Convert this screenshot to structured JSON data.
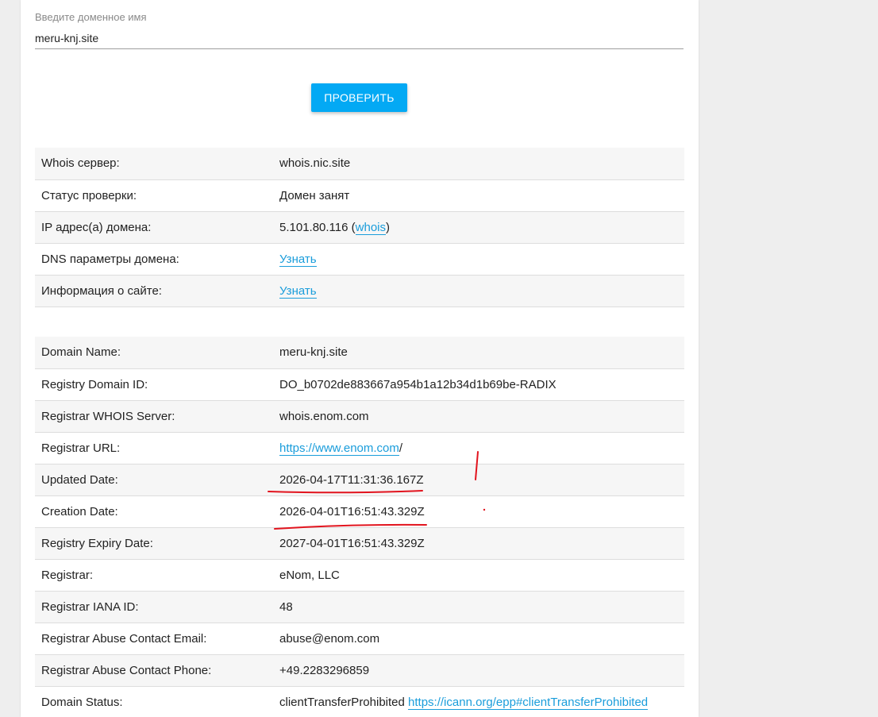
{
  "search": {
    "label": "Введите доменное имя",
    "value": "meru-knj.site"
  },
  "check_button": {
    "label": "ПРОВЕРИТЬ"
  },
  "summary": {
    "whois_server": {
      "key": "Whois сервер:",
      "value": "whois.nic.site"
    },
    "status": {
      "key": "Статус проверки:",
      "value": "Домен занят"
    },
    "ip": {
      "key": "IP адрес(а) домена:",
      "value": "5.101.80.116",
      "open": " (",
      "link": "whois",
      "close": ")"
    },
    "dns": {
      "key": "DNS параметры домена:",
      "link": "Узнать"
    },
    "site_info": {
      "key": "Информация о сайте:",
      "link": "Узнать"
    }
  },
  "whois": {
    "domain_name": {
      "key": "Domain Name:",
      "value": "meru-knj.site"
    },
    "registry_domain_id": {
      "key": "Registry Domain ID:",
      "value": "DO_b0702de883667a954b1a12b34d1b69be-RADIX"
    },
    "registrar_whois_server": {
      "key": "Registrar WHOIS Server:",
      "value": "whois.enom.com"
    },
    "registrar_url": {
      "key": "Registrar URL:",
      "link": "https://www.enom.com",
      "suffix": "/"
    },
    "updated_date": {
      "key": "Updated Date:",
      "value": "2026-04-17T11:31:36.167Z"
    },
    "creation_date": {
      "key": "Creation Date:",
      "value": "2026-04-01T16:51:43.329Z"
    },
    "expiry_date": {
      "key": "Registry Expiry Date:",
      "value": "2027-04-01T16:51:43.329Z"
    },
    "registrar": {
      "key": "Registrar:",
      "value": "eNom, LLC"
    },
    "iana_id": {
      "key": "Registrar IANA ID:",
      "value": "48"
    },
    "abuse_email": {
      "key": "Registrar Abuse Contact Email:",
      "value": "abuse@enom.com"
    },
    "abuse_phone": {
      "key": "Registrar Abuse Contact Phone:",
      "value": "+49.2283296859"
    },
    "domain_status": {
      "key": "Domain Status:",
      "value": "clientTransferProhibited ",
      "link": "https://icann.org/epp#clientTransferProhibited"
    }
  },
  "colors": {
    "accent": "#03a9f4",
    "link": "#1a9ddb",
    "annotation": "#e2141e"
  }
}
